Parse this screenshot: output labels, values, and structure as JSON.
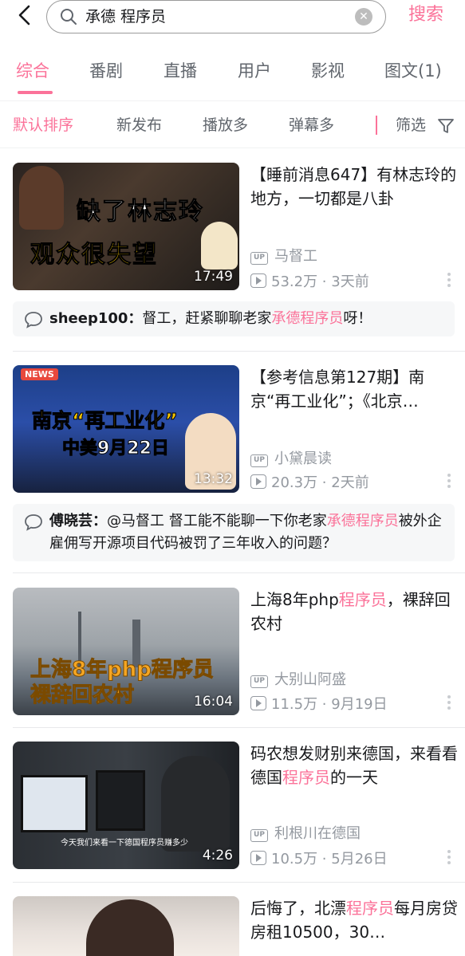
{
  "search": {
    "query": "承德 程序员",
    "button_label": "搜索"
  },
  "tabs": [
    {
      "label": "综合"
    },
    {
      "label": "番剧"
    },
    {
      "label": "直播"
    },
    {
      "label": "用户"
    },
    {
      "label": "影视"
    },
    {
      "label": "图文(1)"
    }
  ],
  "sort": {
    "options": [
      {
        "label": "默认排序"
      },
      {
        "label": "新发布"
      },
      {
        "label": "播放多"
      },
      {
        "label": "弹幕多"
      }
    ],
    "filter_label": "筛选"
  },
  "videos": [
    {
      "title": "【睡前消息647】有林志玲的地方，一切都是八卦",
      "thumb_text_1": "缺了林志玲",
      "thumb_text_2": "观众很失望",
      "duration": "17:49",
      "uploader": "马督工",
      "views": "53.2万",
      "date": "3天前",
      "comment": {
        "user": "sheep100：",
        "before": "督工，赶紧聊聊老家",
        "highlight": "承德程序员",
        "after": "呀！"
      }
    },
    {
      "title": "【参考信息第127期】南京“再工业化”；《北京…",
      "thumb_badge": "NEWS",
      "thumb_text_1": "南京“再工业化”",
      "thumb_text_2": "中美9月22日",
      "duration": "13:32",
      "uploader": "小黛晨读",
      "views": "20.3万",
      "date": "2天前",
      "comment": {
        "user": "傅晓芸：",
        "before": "@马督工 督工能不能聊一下你老家",
        "highlight": "承德程序员",
        "after": "被外企雇佣写开源项目代码被罚了三年收入的问题？"
      }
    },
    {
      "title_pre": "上海8年php",
      "title_hl": "程序员",
      "title_post": "，裸辞回农村",
      "thumb_text_1": "上海8年php程序员",
      "thumb_text_2": "裸辞回农村",
      "duration": "16:04",
      "uploader": "大别山阿盛",
      "views": "11.5万",
      "date": "9月19日"
    },
    {
      "title_pre": "码农想发财别来德国，来看看德国",
      "title_hl": "程序员",
      "title_post": "的一天",
      "thumb_caption": "今天我们来看一下德国程序员赚多少",
      "duration": "4:26",
      "uploader": "利根川在德国",
      "views": "10.5万",
      "date": "5月26日"
    },
    {
      "title_pre": "后悔了，北漂",
      "title_hl": "程序员",
      "title_post": "每月房贷房租10500，30…"
    }
  ],
  "colors": {
    "accent": "#fb7299",
    "text": "#18191c",
    "muted": "#9499a0"
  }
}
